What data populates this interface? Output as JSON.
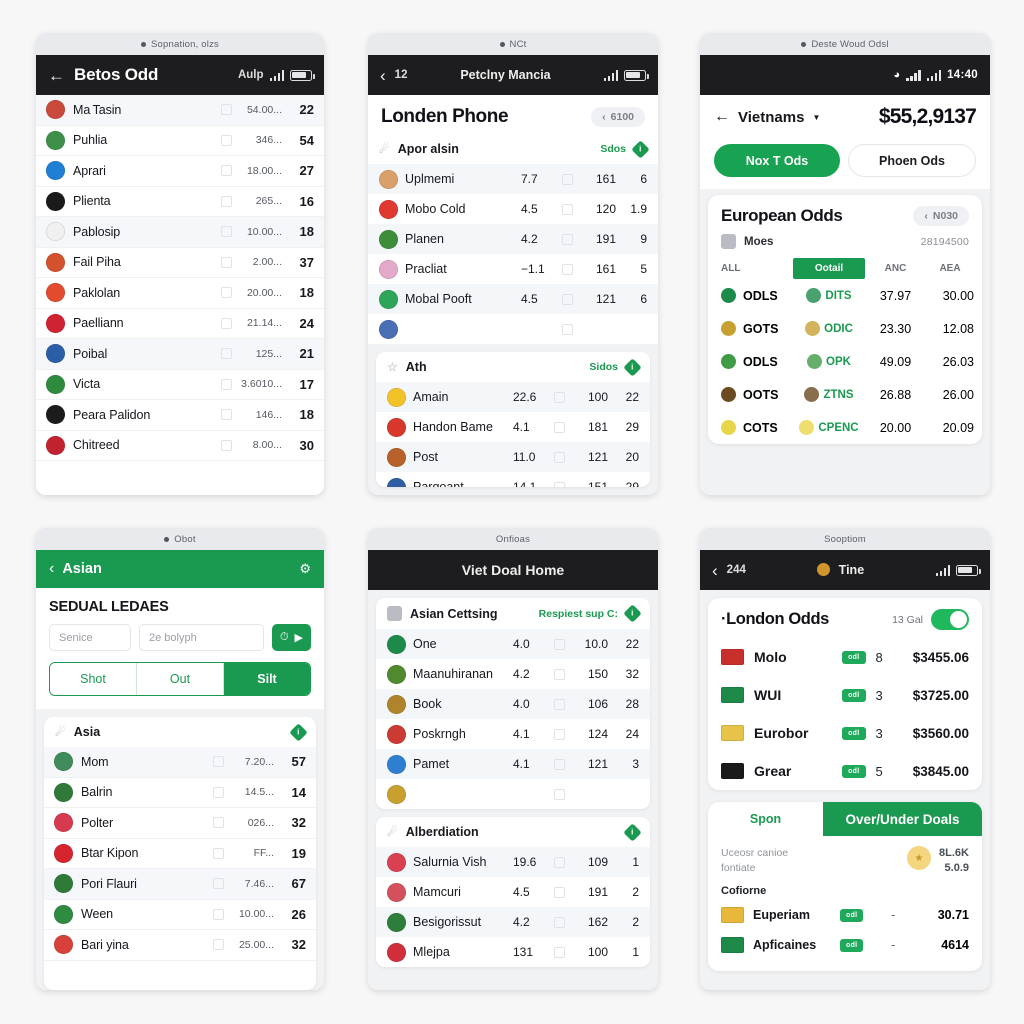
{
  "theme": {
    "green": "#1a9a50",
    "dark": "#1d1d1f",
    "accent_green": "#17a352"
  },
  "panel1": {
    "caption": "Sopnation, olzs",
    "statusbar": {
      "back": "←",
      "title": "Betos Odd",
      "right_label": "Aulp"
    },
    "rows": [
      {
        "name": "Ma Tasin",
        "mid": "54.00...",
        "val": "22",
        "flag": "#c94a3b"
      },
      {
        "name": "Puhlia",
        "mid": "346...",
        "val": "54",
        "flag": "#3d8f4a"
      },
      {
        "name": "Aprari",
        "mid": "18.00...",
        "val": "27",
        "flag": "#1f7fd4"
      },
      {
        "name": "Plienta",
        "mid": "265...",
        "val": "16",
        "flag": "#1a1a1a"
      },
      {
        "name": "Pablosip",
        "mid": "10.00...",
        "val": "18",
        "flag": "#f0f0f0"
      },
      {
        "name": "Fail Piha",
        "mid": "2.00...",
        "val": "37",
        "flag": "#d4512e"
      },
      {
        "name": "Paklolan",
        "mid": "20.00...",
        "val": "18",
        "flag": "#e24b2e"
      },
      {
        "name": "Paelliann",
        "mid": "21.14...",
        "val": "24",
        "flag": "#cf2233"
      },
      {
        "name": "Poibal",
        "mid": "125...",
        "val": "21",
        "flag": "#2b5ea8"
      },
      {
        "name": "Victa",
        "mid": "3.6010...",
        "val": "17",
        "flag": "#2e8a3c"
      },
      {
        "name": "Peara Palidon",
        "mid": "146...",
        "val": "18",
        "flag": "#1c1c1c"
      },
      {
        "name": "Chitreed",
        "mid": "8.00...",
        "val": "30",
        "flag": "#c22230"
      }
    ]
  },
  "panel2": {
    "caption": "NCt",
    "statusbar": {
      "back": "‹",
      "back_label": "12",
      "title": "Petclny Mancia"
    },
    "page_title": "Londen Phone",
    "pill": "6100",
    "card1": {
      "title": "Apor alsin",
      "right_label": "Sdos",
      "rows": [
        {
          "name": "Uplmemi",
          "c2": "7.7",
          "c3": "161",
          "c4": "6",
          "flag": "#d9a06c"
        },
        {
          "name": "Mobo Cold",
          "c2": "4.5",
          "c3": "120",
          "c4": "1.9",
          "flag": "#e0392f"
        },
        {
          "name": "Planen",
          "c2": "4.2",
          "c3": "191",
          "c4": "9",
          "flag": "#3f8c3a"
        },
        {
          "name": "Pracliat",
          "c2": "−1.1",
          "c3": "161",
          "c4": "5",
          "flag": "#e2a9c8"
        },
        {
          "name": "Mobal Pooft",
          "c2": "4.5",
          "c3": "121",
          "c4": "6",
          "flag": "#2fa55a"
        },
        {
          "name": "",
          "c2": "",
          "c3": "",
          "c4": "",
          "flag": "#4a6fb5"
        }
      ]
    },
    "card2": {
      "title": "Ath",
      "right_label": "Sidos",
      "rows": [
        {
          "name": "Amain",
          "c2": "22.6",
          "c3": "100",
          "c4": "22",
          "flag": "#f2c229"
        },
        {
          "name": "Handon Bame",
          "c2": "4.1",
          "c3": "181",
          "c4": "29",
          "flag": "#d7382b"
        },
        {
          "name": "Post",
          "c2": "11.0",
          "c3": "121",
          "c4": "20",
          "flag": "#b8612a"
        },
        {
          "name": "Parqoant",
          "c2": "14.1",
          "c3": "151",
          "c4": "29",
          "flag": "#2f5ea3"
        }
      ]
    }
  },
  "panel3": {
    "caption": "Deste Woud Odsl",
    "statusbar": {
      "clock": "14:40"
    },
    "header": {
      "back": "←",
      "title": "Vietnams",
      "amount": "$55,2,9137"
    },
    "tabs": [
      {
        "label": "Nox T Ods",
        "active": true
      },
      {
        "label": "Phoen Ods",
        "active": false
      }
    ],
    "card": {
      "title": "European Odds",
      "pill": "N030",
      "sub_label": "Moes",
      "sub_value": "28194500",
      "columns": [
        "ALL",
        "Ootail",
        "ANC",
        "AEA"
      ],
      "rows": [
        {
          "c1": "ODLS",
          "c2": "DITS",
          "c3": "37.97",
          "c4": "30.00",
          "flag": "#1c8a4a"
        },
        {
          "c1": "GOTS",
          "c2": "ODIC",
          "c3": "23.30",
          "c4": "12.08",
          "flag": "#c8a032"
        },
        {
          "c1": "ODLS",
          "c2": "OPK",
          "c3": "49.09",
          "c4": "26.03",
          "flag": "#3f9b46"
        },
        {
          "c1": "OOTS",
          "c2": "ZTNS",
          "c3": "26.88",
          "c4": "26.00",
          "flag": "#6b4a22"
        },
        {
          "c1": "COTS",
          "c2": "CPENC",
          "c3": "20.00",
          "c4": "20.09",
          "flag": "#e8d64a"
        }
      ]
    }
  },
  "panel4": {
    "caption": "Obot",
    "header": {
      "back": "‹",
      "title": "Asian",
      "gear": "⚙"
    },
    "search": {
      "heading": "SEDUAL LEDAES",
      "field1_placeholder": "Senice",
      "field2_placeholder": "2e bolyph",
      "go_icon": "clock-icon",
      "arrow_icon": "▶"
    },
    "segments": [
      {
        "label": "Shot",
        "active": false
      },
      {
        "label": "Out",
        "active": false
      },
      {
        "label": "Silt",
        "active": true
      }
    ],
    "card": {
      "title": "Asia"
    },
    "rows": [
      {
        "name": "Mom",
        "mid": "7.20...",
        "val": "57",
        "flag": "#3f8c5a"
      },
      {
        "name": "Balrin",
        "mid": "14.5...",
        "val": "14",
        "flag": "#2f7a38"
      },
      {
        "name": "Polter",
        "mid": "026...",
        "val": "32",
        "flag": "#d63a4e"
      },
      {
        "name": "Btar Kipon",
        "mid": "FF...",
        "val": "19",
        "flag": "#d6252f"
      },
      {
        "name": "Pori Flauri",
        "mid": "7.46...",
        "val": "67",
        "flag": "#2f7a38"
      },
      {
        "name": "Ween",
        "mid": "10.00...",
        "val": "26",
        "flag": "#2f8a42"
      },
      {
        "name": "Bari yina",
        "mid": "25.00...",
        "val": "32",
        "flag": "#d6413a"
      }
    ]
  },
  "panel5": {
    "caption": "Onfioas",
    "statusbar": {
      "title": "Viet Doal Home"
    },
    "card1": {
      "title": "Asian Cettsing",
      "right_label": "Respiest sup C:",
      "rows": [
        {
          "name": "One",
          "c2": "4.0",
          "c3": "10.0",
          "c4": "22",
          "flag": "#1e8a4a"
        },
        {
          "name": "Maanuhiranan",
          "c2": "4.2",
          "c3": "150",
          "c4": "32",
          "flag": "#4f8a2e"
        },
        {
          "name": "Book",
          "c2": "4.0",
          "c3": "106",
          "c4": "28",
          "flag": "#b0842c"
        },
        {
          "name": "Poskrngh",
          "c2": "4.1",
          "c3": "124",
          "c4": "24",
          "flag": "#cc3b33"
        },
        {
          "name": "Pamet",
          "c2": "4.1",
          "c3": "121",
          "c4": "3",
          "flag": "#2f7fd0"
        },
        {
          "name": "",
          "c2": "",
          "c3": "",
          "c4": "",
          "flag": "#c8a030"
        }
      ]
    },
    "card2": {
      "title": "Alberdiation",
      "rows": [
        {
          "name": "Salurnia Vish",
          "c2": "19.6",
          "c3": "109",
          "c4": "1",
          "flag": "#d94050"
        },
        {
          "name": "Mamcuri",
          "c2": "4.5",
          "c3": "191",
          "c4": "2",
          "flag": "#d3515d"
        },
        {
          "name": "Besigorissut",
          "c2": "4.2",
          "c3": "162",
          "c4": "2",
          "flag": "#2e7d3a"
        },
        {
          "name": "Mlejpa",
          "c2": "131",
          "c3": "100",
          "c4": "1",
          "flag": "#d02e3a"
        }
      ]
    }
  },
  "panel6": {
    "caption": "Sooptiom",
    "statusbar": {
      "back": "‹",
      "back_label": "244",
      "title": "Tine"
    },
    "card": {
      "title": "·London Odds",
      "count": "13 Gal",
      "toggle_on": true,
      "rows": [
        {
          "name": "Molo",
          "chip": "odl",
          "num": "8",
          "price": "$3455.06",
          "flag": "#c9302c"
        },
        {
          "name": "WUI",
          "chip": "odl",
          "num": "3",
          "price": "$3725.00",
          "flag": "#1e8a4a"
        },
        {
          "name": "Eurobor",
          "chip": "odl",
          "num": "3",
          "price": "$3560.00",
          "flag": "#e8c34a"
        },
        {
          "name": "Grear",
          "chip": "odl",
          "num": "5",
          "price": "$3845.00",
          "flag": "#1a1a1a"
        }
      ]
    },
    "tabcard": {
      "tabs": [
        {
          "label": "Spon",
          "active": false
        },
        {
          "label": "Over/Under Doals",
          "active": true
        }
      ],
      "note_line1": "Uceosr canioe",
      "note_line2": "fontiate",
      "note_right1": "8L.6K",
      "note_right2": "5.0.9",
      "sub_title": "Cofiorne",
      "rows": [
        {
          "name": "Euperiam",
          "chip": "odl",
          "dash": "-",
          "value": "30.71",
          "flag": "#e8b83a"
        },
        {
          "name": "Apficaines",
          "chip": "odl",
          "dash": "-",
          "value": "4614",
          "flag": "#1e8a4a"
        }
      ]
    }
  }
}
